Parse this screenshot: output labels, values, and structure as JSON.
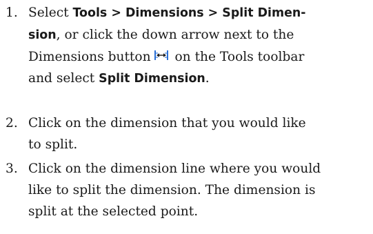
{
  "steps": [
    {
      "number": "1.",
      "lines": [
        {
          "a": "Select ",
          "b": "Tools > Dimensions > Split Dimen-"
        },
        {
          "a": "sion",
          "b": ", or click the down arrow next to the"
        },
        {
          "a": "Dimensions button",
          "b": " on the Tools toolbar"
        },
        {
          "a": "and select ",
          "b": "Split Dimension",
          "c": "."
        }
      ]
    },
    {
      "number": "2.",
      "lines": [
        "Click on the dimension that you would like",
        "to split."
      ]
    },
    {
      "number": "3.",
      "lines": [
        "Click on the dimension line where you would",
        "like to split the dimension. The dimension is",
        "split at the selected point."
      ]
    }
  ],
  "icon": {
    "name": "dimensions-icon",
    "accent": "#2a6fd6"
  }
}
